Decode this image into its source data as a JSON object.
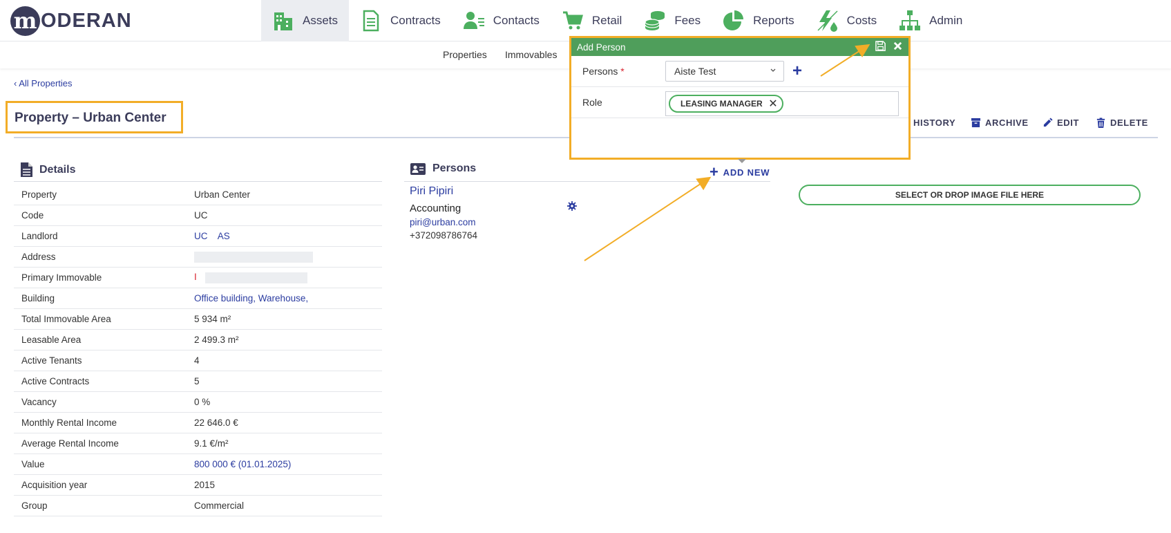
{
  "brand": {
    "logo_mark": "m",
    "logo_text": "ODERAN"
  },
  "nav": [
    {
      "label": "Assets",
      "icon": "building-icon",
      "active": true
    },
    {
      "label": "Contracts",
      "icon": "document-icon"
    },
    {
      "label": "Contacts",
      "icon": "contact-icon"
    },
    {
      "label": "Retail",
      "icon": "cart-icon"
    },
    {
      "label": "Fees",
      "icon": "coins-icon"
    },
    {
      "label": "Reports",
      "icon": "pie-chart-icon"
    },
    {
      "label": "Costs",
      "icon": "energy-icon"
    },
    {
      "label": "Admin",
      "icon": "org-chart-icon"
    }
  ],
  "subnav": [
    "Properties",
    "Immovables"
  ],
  "breadcrumb": "‹ All Properties",
  "page_title": "Property – Urban Center",
  "actions": {
    "history": "HISTORY",
    "archive": "ARCHIVE",
    "edit": "EDIT",
    "delete": "DELETE"
  },
  "details": {
    "title": "Details",
    "rows": [
      {
        "label": "Property",
        "value": "Urban Center"
      },
      {
        "label": "Code",
        "value": "UC"
      },
      {
        "label": "Landlord",
        "value": "UC    AS"
      },
      {
        "label": "Address",
        "value": ""
      },
      {
        "label": "Primary Immovable",
        "value": "I"
      },
      {
        "label": "Building",
        "value": "Office building, Warehouse,"
      },
      {
        "label": "Total Immovable Area",
        "value": "5 934 m²"
      },
      {
        "label": "Leasable Area",
        "value": "2 499.3 m²"
      },
      {
        "label": "Active Tenants",
        "value": "4"
      },
      {
        "label": "Active Contracts",
        "value": "5"
      },
      {
        "label": "Vacancy",
        "value": "0 %"
      },
      {
        "label": "Monthly Rental Income",
        "value": "22 646.0 €"
      },
      {
        "label": "Average Rental Income",
        "value": "9.1 €/m²"
      },
      {
        "label": "Value",
        "value": "800 000 € (01.01.2025)"
      },
      {
        "label": "Acquisition year",
        "value": "2015"
      },
      {
        "label": "Group",
        "value": "Commercial"
      }
    ]
  },
  "persons": {
    "title": "Persons",
    "add_new": "ADD NEW",
    "contact": {
      "name": "Piri Pipiri",
      "department": "Accounting",
      "email": "piri@urban.com",
      "phone": "+372098786764"
    }
  },
  "image_drop": "SELECT OR DROP IMAGE FILE HERE",
  "dialog": {
    "title": "Add Person",
    "persons_label": "Persons",
    "required_mark": "*",
    "persons_value": "Aiste Test",
    "role_label": "Role",
    "role_tag": "LEASING MANAGER"
  },
  "colors": {
    "accent_green": "#4f9e5b",
    "link_blue": "#2b3ca0",
    "highlight": "#f2ad27",
    "nav_text": "#3c3d5a"
  }
}
